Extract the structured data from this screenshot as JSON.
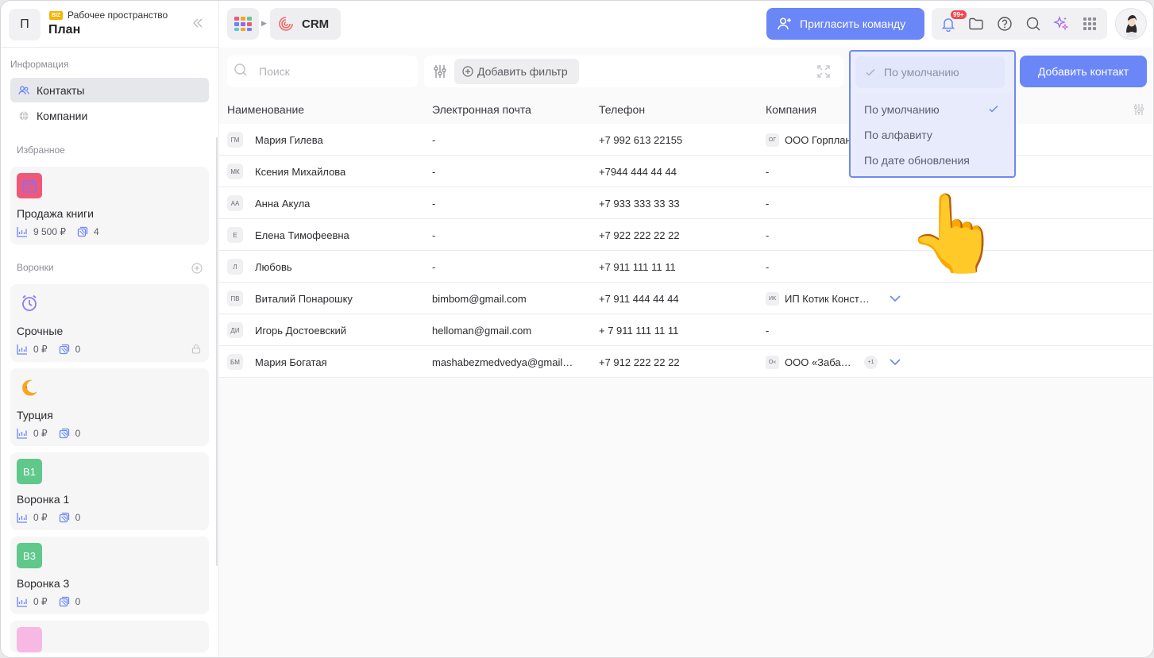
{
  "workspace": {
    "initial": "П",
    "badge": "BIZ",
    "subtitle": "Рабочее пространство",
    "title": "План"
  },
  "sidebar": {
    "info_label": "Информация",
    "nav": [
      {
        "label": "Контакты",
        "active": true
      },
      {
        "label": "Компании",
        "active": false
      }
    ],
    "favorites_label": "Избранное",
    "favorites": [
      {
        "name": "Продажа книги",
        "amount": "9 500 ₽",
        "count": "4"
      }
    ],
    "funnels_label": "Воронки",
    "funnels": [
      {
        "name": "Срочные",
        "amount": "0 ₽",
        "count": "0",
        "locked": true
      },
      {
        "name": "Турция",
        "amount": "0 ₽",
        "count": "0"
      },
      {
        "name": "Воронка 1",
        "badge": "В1",
        "amount": "0 ₽",
        "count": "0"
      },
      {
        "name": "Воронка 3",
        "badge": "В3",
        "amount": "0 ₽",
        "count": "0"
      }
    ]
  },
  "topbar": {
    "crm_label": "CRM",
    "invite_label": "Пригласить команду",
    "notifications_badge": "99+"
  },
  "toolbar": {
    "search_placeholder": "Поиск",
    "add_filter_label": "Добавить фильтр",
    "add_contact_label": "Добавить контакт"
  },
  "table": {
    "columns": [
      "Наименование",
      "Электронная почта",
      "Телефон",
      "Компания"
    ],
    "rows": [
      {
        "initials": "ГМ",
        "name": "Мария Гилева",
        "email": "-",
        "phone": "+7 992 613 22155",
        "company_initials": "ОГ",
        "company": "ООО Горплан"
      },
      {
        "initials": "МК",
        "name": "Ксения Михайлова",
        "email": "-",
        "phone": "+7944 444 44 44",
        "company": "-"
      },
      {
        "initials": "АА",
        "name": "Анна Акула",
        "email": "-",
        "phone": "+7 933 333 33 33",
        "company": "-"
      },
      {
        "initials": "Е",
        "name": "Елена Тимофеевна",
        "email": "-",
        "phone": "+7 922 222 22 22",
        "company": "-"
      },
      {
        "initials": "Л",
        "name": "Любовь",
        "email": "-",
        "phone": "+7 911 111 11 11",
        "company": "-"
      },
      {
        "initials": "ПВ",
        "name": "Виталий Понарошку",
        "email": "bimbom@gmail.com",
        "phone": "+7 911 444 44 44",
        "company_initials": "ИК",
        "company": "ИП Котик Конст…",
        "expand": true
      },
      {
        "initials": "ДИ",
        "name": "Игорь Достоевский",
        "email": "helloman@gmail.com",
        "phone": "+ 7 911 111 11 11",
        "company": "-"
      },
      {
        "initials": "БМ",
        "name": "Мария Богатая",
        "email": "mashabezmedvedya@gmail…",
        "phone": "+7 912 222 22 22",
        "company_initials": "О«",
        "company": "ООО «Заба…",
        "extra": "+1",
        "expand": true
      }
    ]
  },
  "sort": {
    "current": "По умолчанию",
    "options": [
      "По умолчанию",
      "По алфавиту",
      "По дате обновления"
    ],
    "selected_index": 0
  },
  "colors": {
    "accent": "#6b86f7",
    "sort_border": "#7088f2"
  }
}
